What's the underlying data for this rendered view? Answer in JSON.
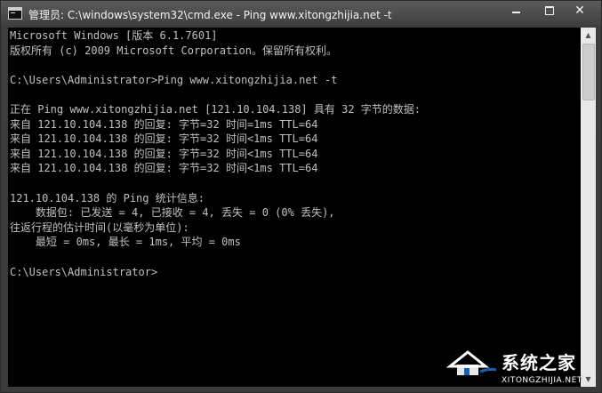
{
  "window": {
    "title": "管理员: C:\\windows\\system32\\cmd.exe - Ping  www.xitongzhijia.net -t",
    "icon": "console-icon",
    "controls": {
      "minimize_icon": "minimize-icon",
      "maximize_icon": "maximize-icon",
      "close_label": "✕"
    }
  },
  "console": {
    "text_color": "#c0c0c0",
    "background": "#000000",
    "lines": [
      "Microsoft Windows [版本 6.1.7601]",
      "版权所有 (c) 2009 Microsoft Corporation。保留所有权利。",
      "",
      "C:\\Users\\Administrator>Ping www.xitongzhijia.net -t",
      "",
      "正在 Ping www.xitongzhijia.net [121.10.104.138] 具有 32 字节的数据:",
      "来自 121.10.104.138 的回复: 字节=32 时间=1ms TTL=64",
      "来自 121.10.104.138 的回复: 字节=32 时间<1ms TTL=64",
      "来自 121.10.104.138 的回复: 字节=32 时间<1ms TTL=64",
      "来自 121.10.104.138 的回复: 字节=32 时间<1ms TTL=64",
      "",
      "121.10.104.138 的 Ping 统计信息:",
      "    数据包: 已发送 = 4, 已接收 = 4, 丢失 = 0 (0% 丢失),",
      "往返行程的估计时间(以毫秒为单位):",
      "    最短 = 0ms, 最长 = 1ms, 平均 = 0ms",
      "",
      "C:\\Users\\Administrator>"
    ]
  },
  "scrollbar": {
    "up_icon": "scroll-up-arrow-icon",
    "down_icon": "scroll-down-arrow-icon"
  },
  "watermark": {
    "name": "系统之家",
    "url": "XITONGZHIJIA.NET"
  }
}
